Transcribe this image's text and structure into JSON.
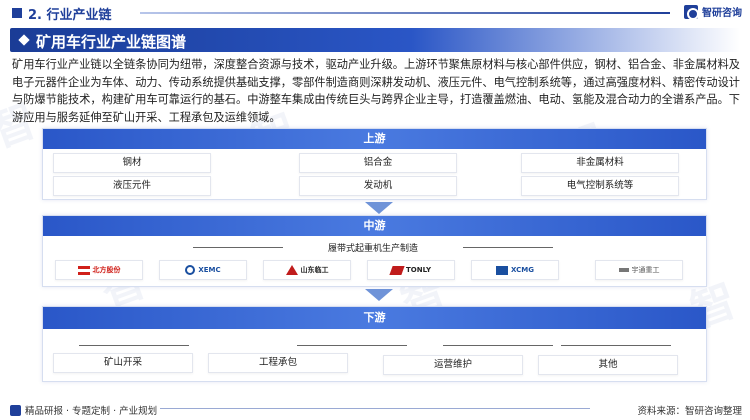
{
  "header": {
    "section_title": "2. 行业产业链",
    "brand_name": "智研咨询"
  },
  "title_bar": {
    "title": "矿用车行业产业链图谱"
  },
  "intro": "矿用车行业产业链以全链条协同为纽带，深度整合资源与技术，驱动产业升级。上游环节聚焦原材料与核心部件供应，钢材、铝合金、非金属材料及电子元器件企业为车体、动力、传动系统提供基础支撑，零部件制造商则深耕发动机、液压元件、电气控制系统等，通过高强度材料、精密传动设计与防爆节能技术，构建矿用车可靠运行的基石。中游整车集成由传统巨头与跨界企业主导，打造覆盖燃油、电动、氢能及混合动力的全谱系产品。下游应用与服务延伸至矿山开采、工程承包及运维领域。",
  "upstream": {
    "label": "上游",
    "items": [
      "钢材",
      "铝合金",
      "非金属材料",
      "液压元件",
      "发动机",
      "电气控制系统等"
    ]
  },
  "midstream": {
    "label": "中游",
    "sublabel": "履带式起重机生产制造",
    "companies": [
      {
        "name": "北方股份",
        "color": "#d0201a"
      },
      {
        "name": "XEMC",
        "color": "#1a4fa0"
      },
      {
        "name": "山东临工",
        "color": "#c01c1c"
      },
      {
        "name": "TONLY",
        "color": "#c01c1c"
      },
      {
        "name": "XCMG",
        "color": "#1a4fa0"
      },
      {
        "name": "宇通重工",
        "color": "#555555"
      }
    ]
  },
  "downstream": {
    "label": "下游",
    "items": [
      "矿山开采",
      "工程承包",
      "运营维护",
      "其他"
    ]
  },
  "footer": {
    "left_text": "精品研报 · 专题定制 · 产业规划",
    "right_text": "资料来源：智研咨询整理"
  },
  "colors": {
    "primary": "#1f3f9a",
    "accent": "#2a57c8",
    "arrow": "#6f93d8"
  }
}
